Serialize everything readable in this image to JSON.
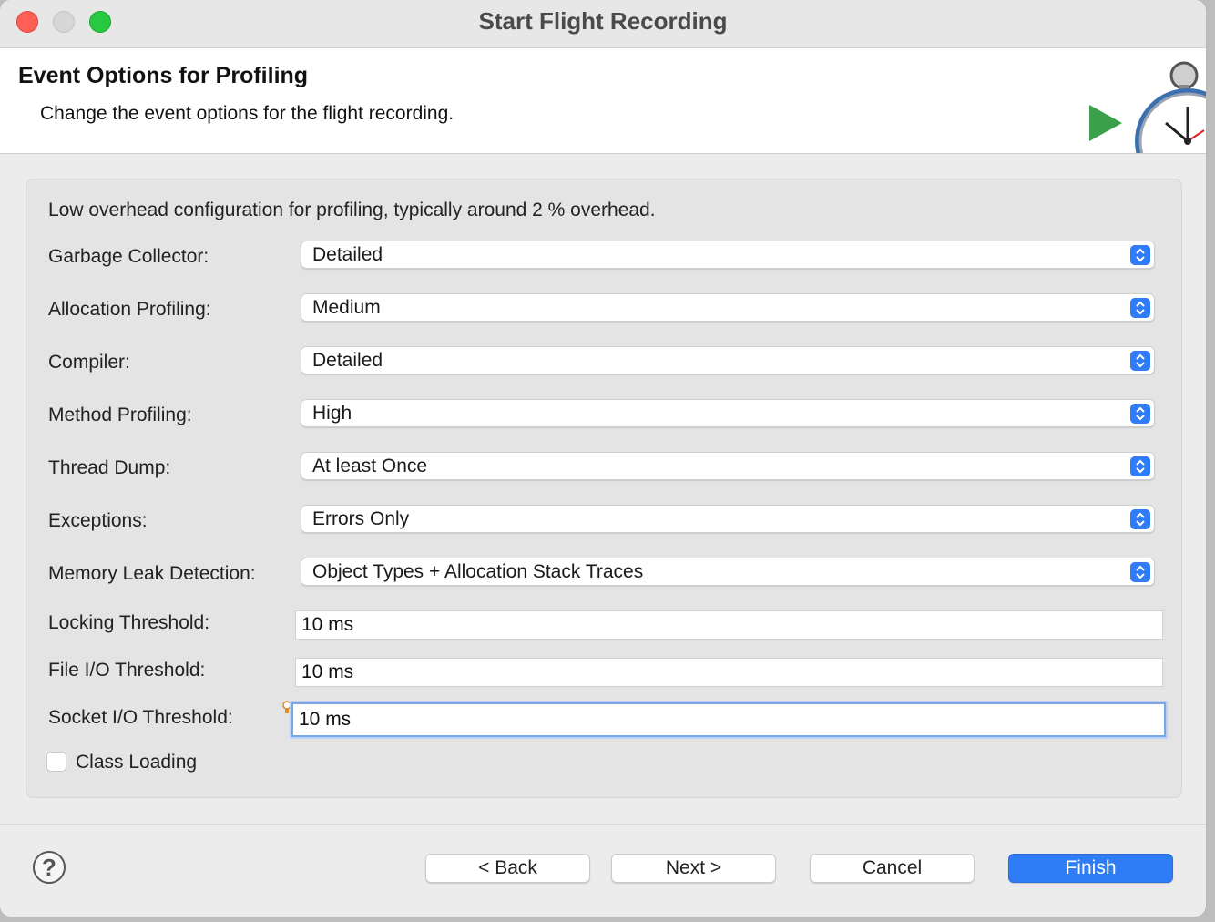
{
  "window": {
    "title": "Start Flight Recording"
  },
  "header": {
    "title": "Event Options for Profiling",
    "description": "Change the event options for the flight recording."
  },
  "form": {
    "description": "Low overhead configuration for profiling, typically around 2 % overhead.",
    "combos": [
      {
        "label": "Garbage Collector:",
        "value": "Detailed"
      },
      {
        "label": "Allocation Profiling:",
        "value": "Medium"
      },
      {
        "label": "Compiler:",
        "value": "Detailed"
      },
      {
        "label": "Method Profiling:",
        "value": "High"
      },
      {
        "label": "Thread Dump:",
        "value": "At least Once"
      },
      {
        "label": "Exceptions:",
        "value": "Errors Only"
      },
      {
        "label": "Memory Leak Detection:",
        "value": "Object Types + Allocation Stack Traces"
      }
    ],
    "fields": [
      {
        "label": "Locking Threshold:",
        "value": "10 ms"
      },
      {
        "label": "File I/O Threshold:",
        "value": "10 ms"
      },
      {
        "label": "Socket I/O Threshold:",
        "value": "10 ms"
      }
    ],
    "class_loading": {
      "label": "Class Loading",
      "checked": false
    }
  },
  "footer": {
    "help": "?",
    "back": "< Back",
    "next": "Next >",
    "cancel": "Cancel",
    "finish": "Finish"
  },
  "colors": {
    "accent": "#2e7cf6",
    "close": "#fe5f57",
    "maximize": "#28c840"
  }
}
